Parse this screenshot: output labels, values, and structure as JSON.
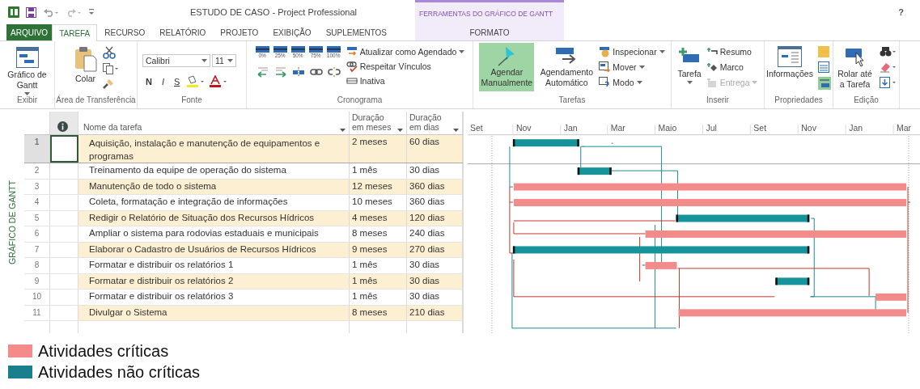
{
  "title_bar": {
    "title": "ESTUDO DE CASO - Project Professional",
    "context_group": "FERRAMENTAS DO GRÁFICO DE GANTT",
    "help": "?"
  },
  "tabs": [
    {
      "label": "ARQUIVO",
      "kind": "file",
      "selected": false
    },
    {
      "label": "TAREFA",
      "kind": "tab",
      "selected": true
    },
    {
      "label": "RECURSO",
      "kind": "tab",
      "selected": false
    },
    {
      "label": "RELATÓRIO",
      "kind": "tab",
      "selected": false
    },
    {
      "label": "PROJETO",
      "kind": "tab",
      "selected": false
    },
    {
      "label": "EXIBIÇÃO",
      "kind": "tab",
      "selected": false
    },
    {
      "label": "SUPLEMENTOS",
      "kind": "tab",
      "selected": false
    },
    {
      "label": "FORMATO",
      "kind": "contextual",
      "selected": false
    }
  ],
  "ribbon": {
    "view": {
      "group": "Exibir",
      "label": "Gráfico de Gantt"
    },
    "clipboard": {
      "group": "Área de Transferência",
      "paste": "Colar"
    },
    "font": {
      "group": "Fonte",
      "family": "Calibri",
      "size": "11",
      "bold": "N",
      "italic": "I",
      "underline": "S"
    },
    "schedule": {
      "group": "Cronograma",
      "percents": [
        "0%",
        "25%",
        "50%",
        "75%",
        "100%"
      ],
      "commands": [
        "Atualizar como Agendado",
        "Respeitar Vínculos",
        "Inativa"
      ]
    },
    "tasks": {
      "group": "Tarefas",
      "modes": [
        {
          "label": "Agendar Manualmente",
          "selected": true
        },
        {
          "label": "Agendamento Automático",
          "selected": false
        }
      ],
      "commands": [
        "Inspecionar",
        "Mover",
        "Modo"
      ]
    },
    "insert": {
      "group": "Inserir",
      "task": "Tarefa",
      "commands": [
        {
          "label": "Resumo",
          "disabled": false
        },
        {
          "label": "Marco",
          "disabled": false
        },
        {
          "label": "Entrega",
          "disabled": true
        }
      ]
    },
    "properties": {
      "group": "Propriedades",
      "info": "Informações"
    },
    "editing": {
      "group": "Edição",
      "scroll": "Rolar até a Tarefa"
    }
  },
  "view_label": "GRÁFICO DE GANTT",
  "table": {
    "columns": [
      "Nome da tarefa",
      "Duração em meses",
      "Duração em dias"
    ],
    "rows": [
      {
        "id": "1",
        "name": "Aquisição, instalação e manutenção de equipamentos e programas",
        "months": "2 meses",
        "days": "60 dias",
        "critical": false,
        "selected": true
      },
      {
        "id": "2",
        "name": "Treinamento da equipe de operação do sistema",
        "months": "1 mês",
        "days": "30 dias",
        "critical": false,
        "selected": false
      },
      {
        "id": "3",
        "name": "Manutenção de todo o sistema",
        "months": "12 meses",
        "days": "360 dias",
        "critical": true,
        "selected": false
      },
      {
        "id": "4",
        "name": "Coleta, formatação e integração de informações",
        "months": "10 meses",
        "days": "360 dias",
        "critical": true,
        "selected": false
      },
      {
        "id": "5",
        "name": "Redigir o Relatório de Situação dos Recursos Hídricos",
        "months": "4 meses",
        "days": "120 dias",
        "critical": false,
        "selected": false
      },
      {
        "id": "6",
        "name": "Ampliar o sistema para rodovias estaduais e municipais",
        "months": "8 meses",
        "days": "240 dias",
        "critical": true,
        "selected": false
      },
      {
        "id": "7",
        "name": "Elaborar o Cadastro de Usuários de Recursos Hídricos",
        "months": "9 meses",
        "days": "270 dias",
        "critical": false,
        "selected": false
      },
      {
        "id": "8",
        "name": "Formatar e distribuir os relatórios 1",
        "months": "1 mês",
        "days": "30 dias",
        "critical": true,
        "selected": false
      },
      {
        "id": "9",
        "name": "Formatar e distribuir os relatórios 2",
        "months": "1 mês",
        "days": "30 dias",
        "critical": false,
        "selected": false
      },
      {
        "id": "10",
        "name": "Formatar e distribuir os relatórios 3",
        "months": "1 mês",
        "days": "30 dias",
        "critical": true,
        "selected": false
      },
      {
        "id": "11",
        "name": "Divulgar o Sistema",
        "months": "8 meses",
        "days": "210 dias",
        "critical": true,
        "selected": false
      }
    ]
  },
  "timescale": [
    "Set",
    "Nov",
    "Jan",
    "Mar",
    "Maio",
    "Jul",
    "Set",
    "Nov",
    "Jan",
    "Mar"
  ],
  "legend": [
    {
      "label": "Atividades críticas",
      "color": "#f48b8b"
    },
    {
      "label": "Atividades não críticas",
      "color": "#17808c"
    }
  ]
}
